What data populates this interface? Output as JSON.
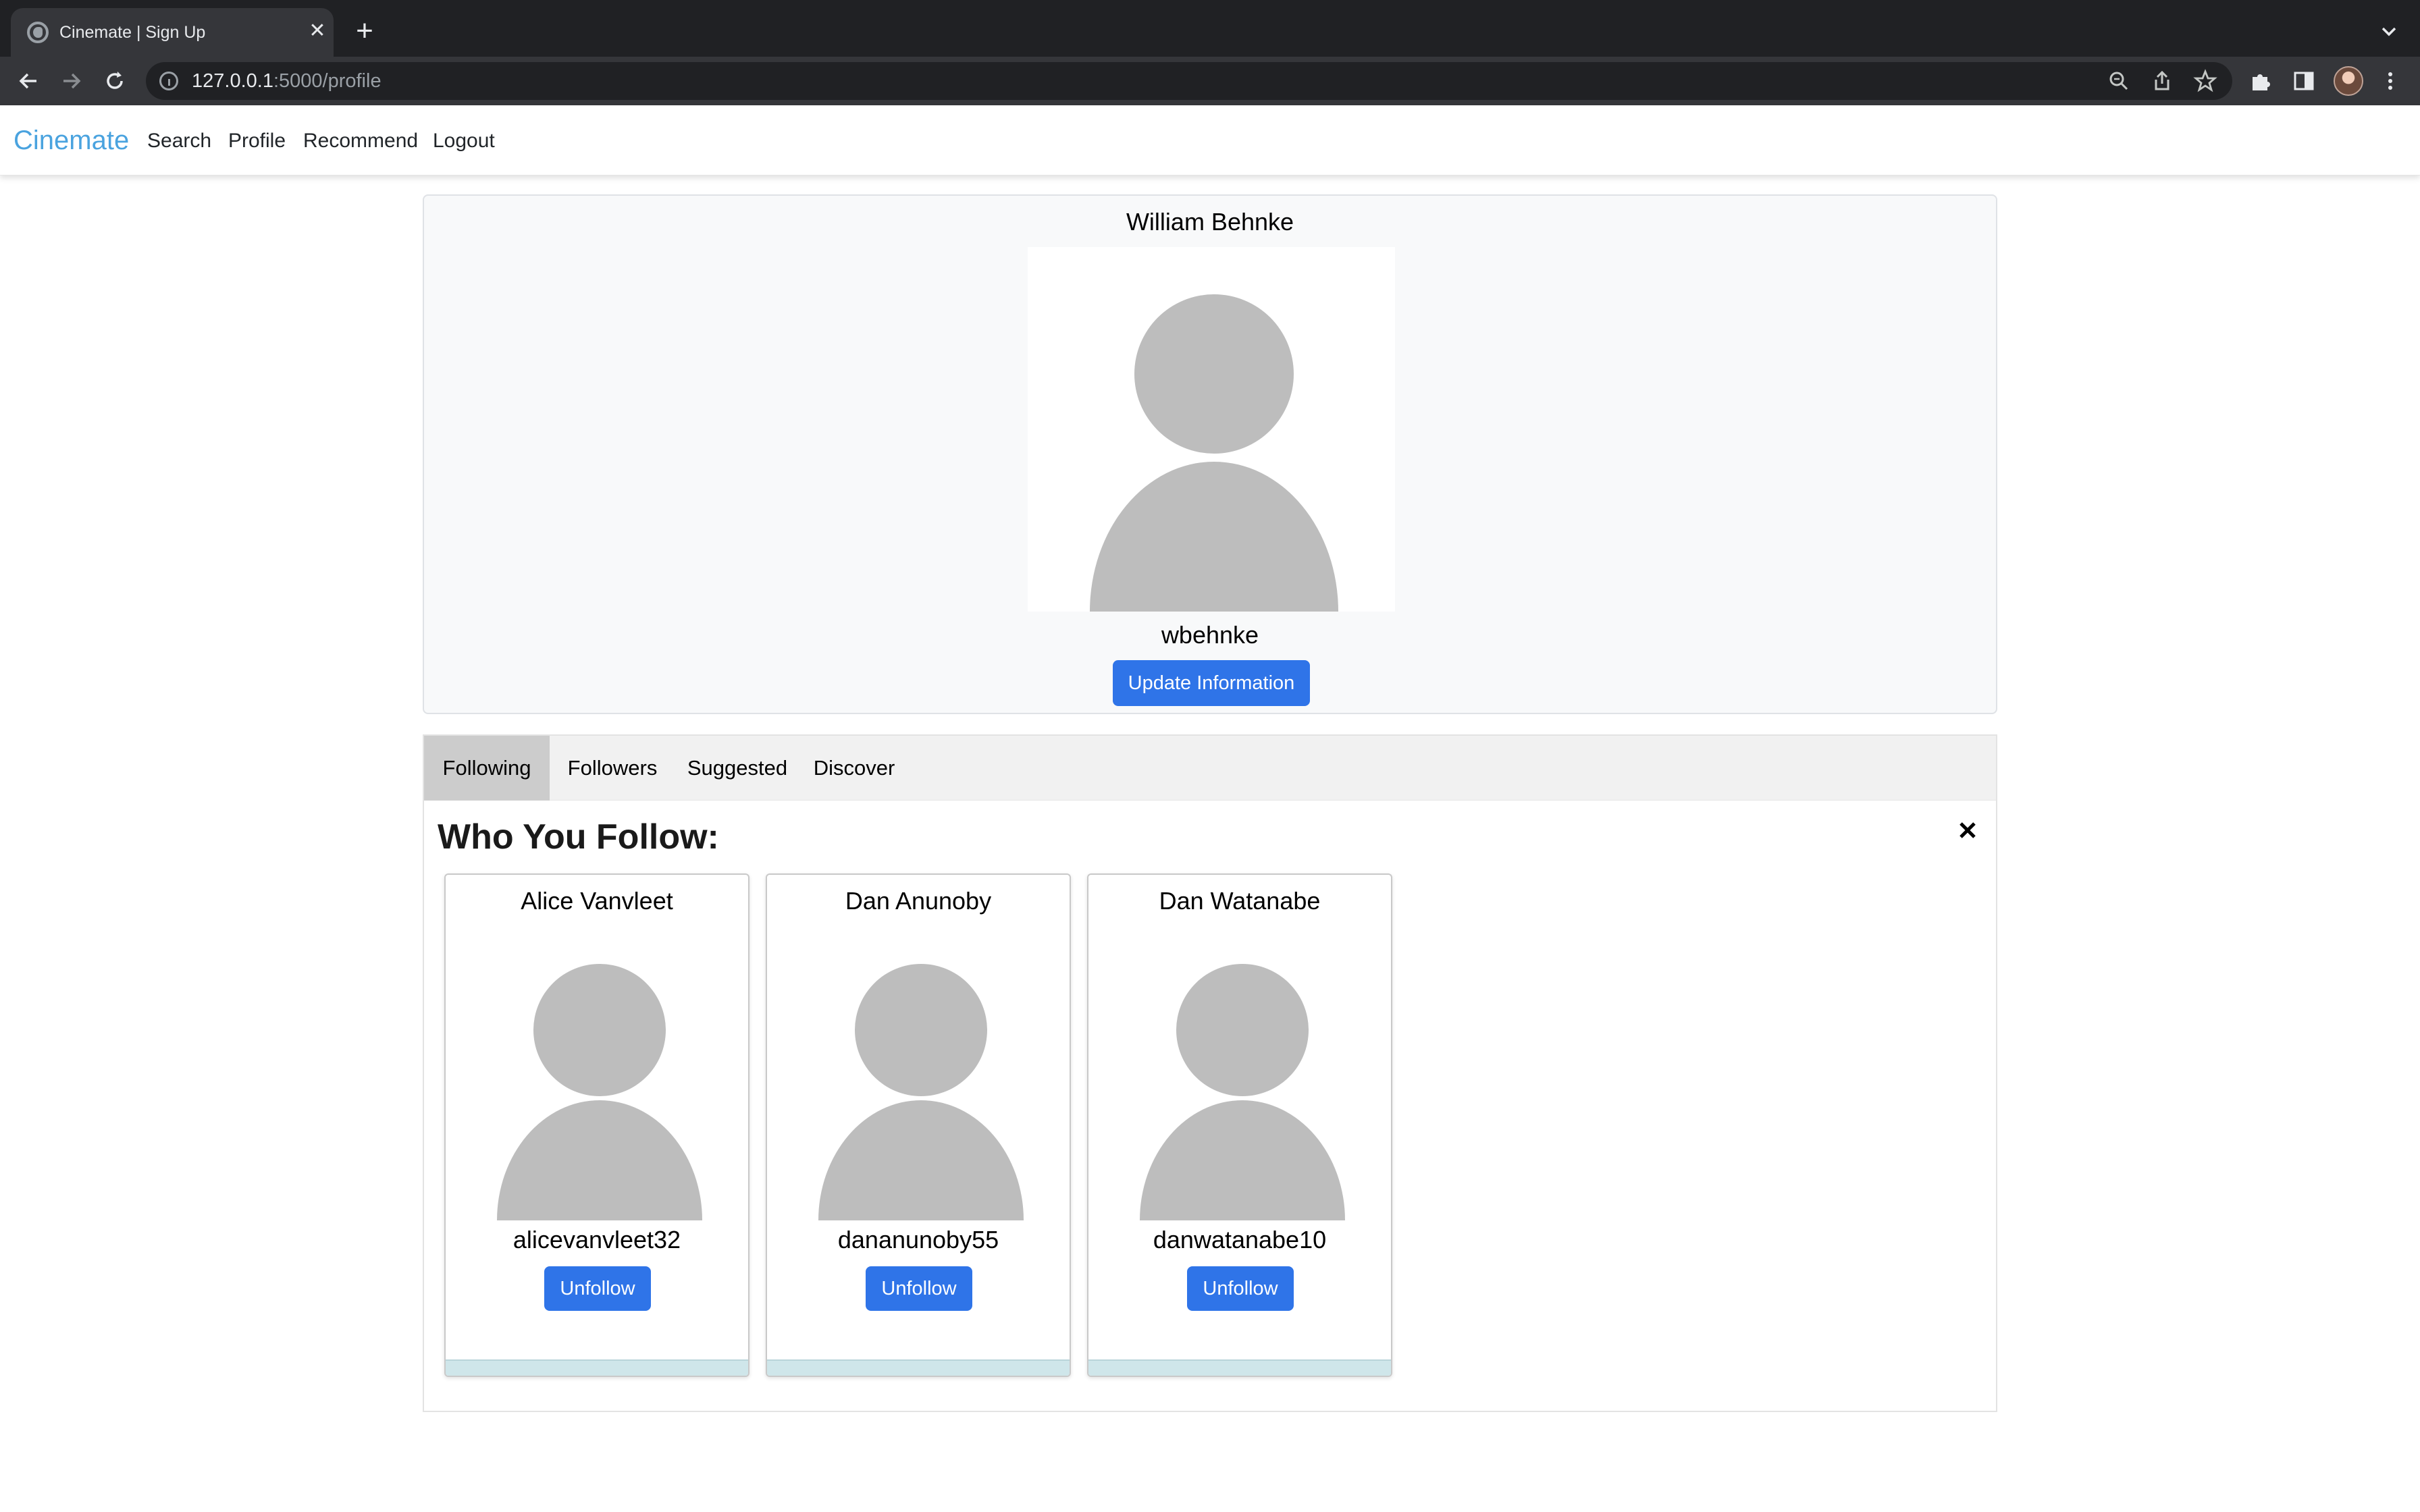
{
  "browser": {
    "tab_title": "Cinemate | Sign Up",
    "url_host": "127.0.0.1",
    "url_path": ":5000/profile"
  },
  "navbar": {
    "brand": "Cinemate",
    "links": [
      "Search",
      "Profile",
      "Recommend",
      "Logout"
    ],
    "brand_color": "#4aa3df"
  },
  "profile": {
    "full_name": "William Behnke",
    "username": "wbehnke",
    "update_label": "Update Information"
  },
  "tabs": {
    "items": [
      "Following",
      "Followers",
      "Suggested",
      "Discover"
    ],
    "active": "Following"
  },
  "following": {
    "title": "Who You Follow:",
    "users": [
      {
        "name": "Alice Vanvleet",
        "username": "alicevanvleet32",
        "action": "Unfollow"
      },
      {
        "name": "Dan Anunoby",
        "username": "dananunoby55",
        "action": "Unfollow"
      },
      {
        "name": "Dan Watanabe",
        "username": "danwatanabe10",
        "action": "Unfollow"
      }
    ]
  },
  "colors": {
    "primary_button": "#2f74e8",
    "active_tab": "#cccccc",
    "avatar_placeholder": "#bdbdbd"
  },
  "icons": {
    "close": "close-icon",
    "avatar": "user-placeholder-icon"
  }
}
